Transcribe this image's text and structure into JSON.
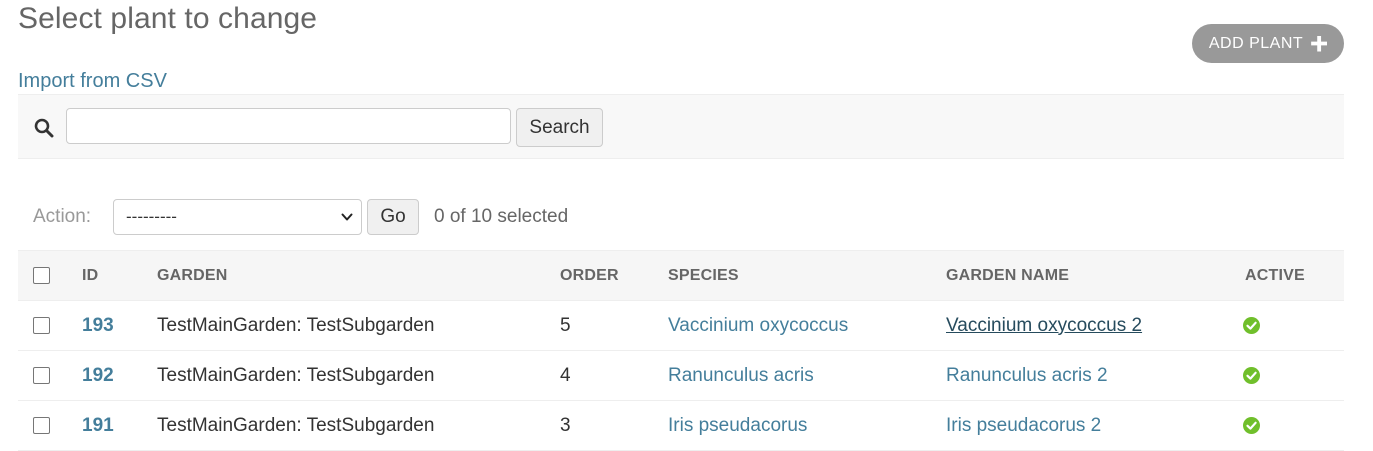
{
  "header": {
    "title": "Select plant to change",
    "add_button_label": "ADD PLANT",
    "import_link": "Import from CSV"
  },
  "search": {
    "value": "",
    "button_label": "Search",
    "icon": "search-icon"
  },
  "actions": {
    "label": "Action:",
    "selected_option": "---------",
    "go_label": "Go",
    "selection_count": "0 of 10 selected"
  },
  "table": {
    "columns": [
      "ID",
      "GARDEN",
      "ORDER",
      "SPECIES",
      "GARDEN NAME",
      "ACTIVE"
    ],
    "rows": [
      {
        "id": "193",
        "garden": "TestMainGarden: TestSubgarden",
        "order": "5",
        "species": "Vaccinium oxycoccus",
        "garden_name": "Vaccinium oxycoccus 2",
        "active": "true"
      },
      {
        "id": "192",
        "garden": "TestMainGarden: TestSubgarden",
        "order": "4",
        "species": "Ranunculus acris",
        "garden_name": "Ranunculus acris 2",
        "active": "true"
      },
      {
        "id": "191",
        "garden": "TestMainGarden: TestSubgarden",
        "order": "3",
        "species": "Iris pseudacorus",
        "garden_name": "Iris pseudacorus 2",
        "active": "true"
      }
    ]
  },
  "colors": {
    "link": "#447e9b",
    "active_green": "#70bf2b",
    "add_button_bg": "#999999"
  }
}
